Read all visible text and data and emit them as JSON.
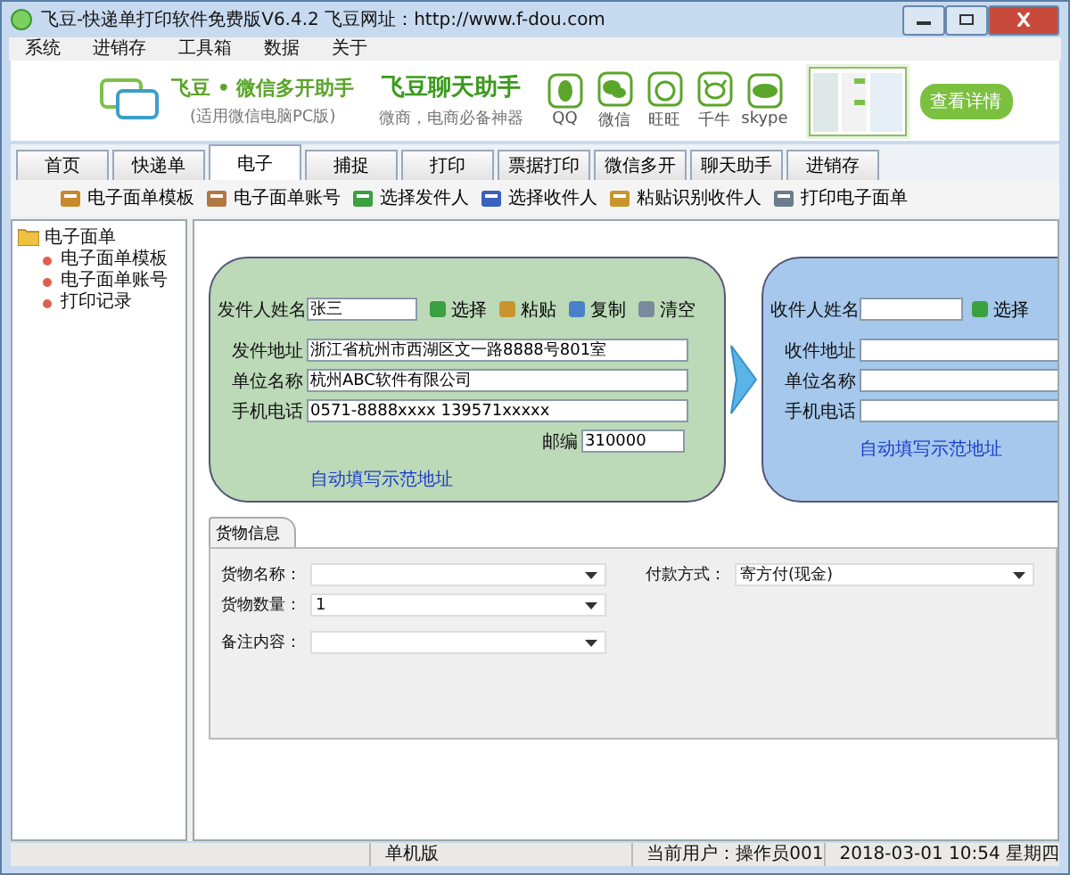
{
  "window": {
    "title": "飞豆-快递单打印软件免费版V6.4.2  飞豆网址：http://www.f-dou.com"
  },
  "menu": [
    "系统",
    "进销存",
    "工具箱",
    "数据",
    "关于"
  ],
  "banner": {
    "product": "飞豆 • 微信多开助手",
    "product_note": "(适用微信电脑PC版)",
    "headline": "飞豆聊天助手",
    "slogan": "微商，电商必备神器",
    "apps": [
      {
        "kind": "qq",
        "label": "QQ"
      },
      {
        "kind": "wechat",
        "label": "微信"
      },
      {
        "kind": "wangwang",
        "label": "旺旺"
      },
      {
        "kind": "qianniu",
        "label": "千牛"
      },
      {
        "kind": "skype",
        "label": "skype"
      }
    ],
    "button": "查看详情"
  },
  "tabs": [
    {
      "label": "首页",
      "selected": false
    },
    {
      "label": "快递单",
      "selected": false
    },
    {
      "label": "电子",
      "selected": true
    },
    {
      "label": "捕捉",
      "selected": false
    },
    {
      "label": "打印",
      "selected": false
    },
    {
      "label": "票据打印",
      "selected": false
    },
    {
      "label": "微信多开",
      "selected": false
    },
    {
      "label": "聊天助手",
      "selected": false
    },
    {
      "label": "进销存",
      "selected": false
    }
  ],
  "toolbar": [
    {
      "kind": "template",
      "label": "电子面单模板"
    },
    {
      "kind": "account",
      "label": "电子面单账号"
    },
    {
      "kind": "sender",
      "label": "选择发件人"
    },
    {
      "kind": "receiver",
      "label": "选择收件人"
    },
    {
      "kind": "paste",
      "label": "粘贴识别收件人"
    },
    {
      "kind": "print",
      "label": "打印电子面单"
    }
  ],
  "sidebar": {
    "items": [
      {
        "label": "电子面单",
        "expanded": true,
        "children": [
          {
            "label": "电子面单模板"
          },
          {
            "label": "电子面单账号"
          },
          {
            "label": "打印记录"
          }
        ]
      }
    ]
  },
  "sender": {
    "name_label": "发件人姓名",
    "name": "张三",
    "actions": [
      {
        "kind": "select",
        "label": "选择"
      },
      {
        "kind": "paste",
        "label": "粘贴"
      },
      {
        "kind": "copy",
        "label": "复制"
      },
      {
        "kind": "clear",
        "label": "清空"
      }
    ],
    "fields": [
      {
        "label": "发件地址",
        "value": "浙江省杭州市西湖区文一路8888号801室"
      },
      {
        "label": "单位名称",
        "value": "杭州ABC软件有限公司"
      },
      {
        "label": "手机电话",
        "value": "0571-8888xxxx 139571xxxxx"
      }
    ],
    "postcode_label": "邮编",
    "postcode": "310000",
    "link": "自动填写示范地址"
  },
  "receiver": {
    "name_label": "收件人姓名",
    "actions": [
      {
        "kind": "select",
        "label": "选择"
      }
    ],
    "fields": [
      {
        "label": "收件地址"
      },
      {
        "label": "单位名称"
      },
      {
        "label": "手机电话"
      }
    ],
    "link": "自动填写示范地址"
  },
  "goods": {
    "tab": "货物信息",
    "fields": [
      {
        "label": "货物名称："
      },
      {
        "label": "货物数量：",
        "value": "1"
      },
      {
        "label": "备注内容："
      }
    ],
    "payment": {
      "label": "付款方式：",
      "value": "寄方付(现金)"
    }
  },
  "status_bar": {
    "mode": "单机版",
    "user": "当前用户：操作员001",
    "datetime": "2018-03-01 10:54 星期四"
  }
}
